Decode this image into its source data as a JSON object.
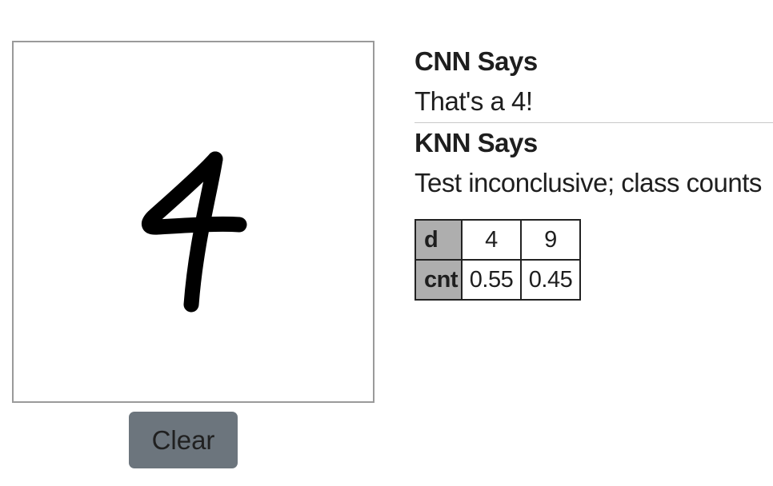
{
  "canvas": {
    "drawn_digit": "4",
    "stroke_color": "#000000"
  },
  "clear_button": {
    "label": "Clear",
    "color": "#6c757d"
  },
  "cnn": {
    "heading": "CNN Says",
    "verdict": "That's a 4!"
  },
  "knn": {
    "heading": "KNN Says",
    "verdict": "Test inconclusive; class counts",
    "table": {
      "header_label": "d",
      "count_label": "cnt",
      "classes": [
        "4",
        "9"
      ],
      "counts": [
        "0.55",
        "0.45"
      ]
    }
  }
}
